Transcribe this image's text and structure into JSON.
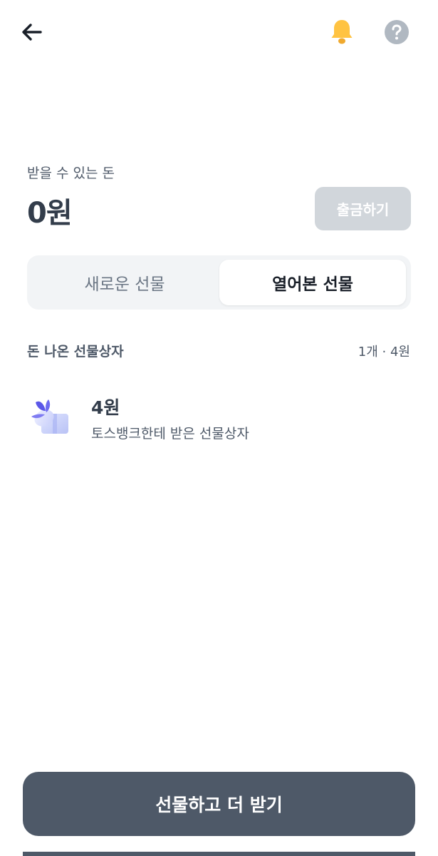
{
  "balance": {
    "label": "받을 수 있는 돈",
    "amount": "0원",
    "withdraw_label": "출금하기"
  },
  "tabs": [
    {
      "label": "새로운 선물",
      "active": false
    },
    {
      "label": "열어본 선물",
      "active": true
    }
  ],
  "section": {
    "title": "돈 나온 선물상자",
    "summary": "1개 · 4원"
  },
  "gifts": [
    {
      "amount": "4원",
      "description": "토스뱅크한테 받은 선물상자"
    }
  ],
  "cta": {
    "label": "선물하고 더 받기"
  },
  "icons": {
    "back": "arrow-left-icon",
    "notification": "bell-icon",
    "help": "question-mark-icon",
    "gift": "gift-box-icon"
  },
  "colors": {
    "bell": "#FFC342",
    "help_circle": "#B0B8C1",
    "withdraw_disabled": "#D1D6DB",
    "cta_background": "#4E5968",
    "segment_background": "#F2F4F6"
  }
}
